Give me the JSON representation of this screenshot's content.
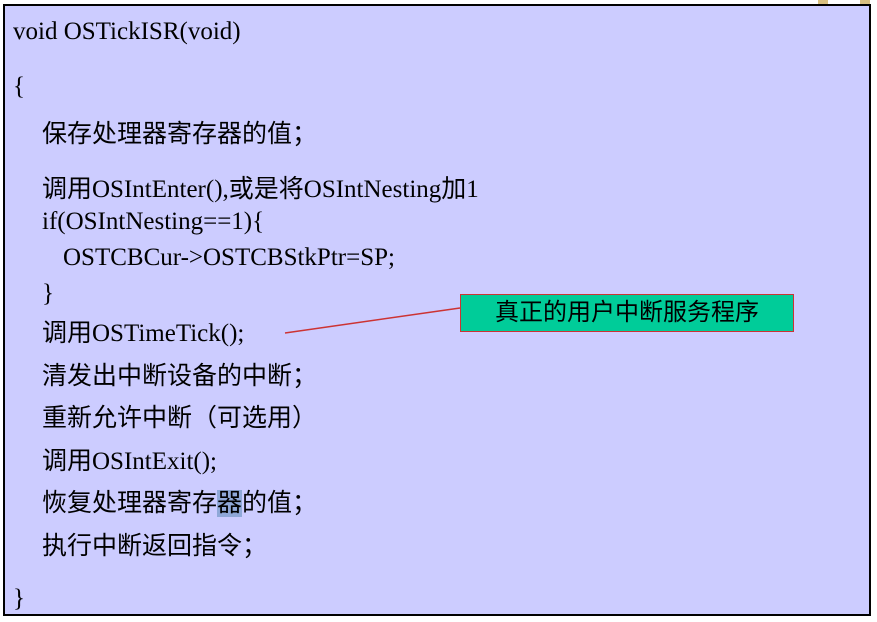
{
  "code": {
    "signature": "void OSTickISR(void)",
    "open_brace": "{",
    "save_registers": "保存处理器寄存器的值；",
    "call_int_enter": "调用OSIntEnter(),或是将OSIntNesting加1",
    "if_nesting": "if(OSIntNesting==1){",
    "save_sp": "OSTCBCur->OSTCBStkPtr=SP;",
    "close_if": "}",
    "call_time_tick": "调用OSTimeTick();",
    "clear_interrupt": "清发出中断设备的中断；",
    "reenable_interrupt": "重新允许中断（可选用）",
    "call_int_exit": "调用OSIntExit();",
    "restore_prefix": "恢复处理器寄存",
    "restore_highlight": "器",
    "restore_suffix": "的值；",
    "return_from_interrupt": "执行中断返回指令；",
    "close_brace": "}"
  },
  "callout": {
    "label": "真正的用户中断服务程序"
  },
  "colors": {
    "box_background": "#ccccff",
    "callout_background": "#00cc99",
    "callout_border": "#cc3333",
    "highlight": "#8fa8d8"
  }
}
